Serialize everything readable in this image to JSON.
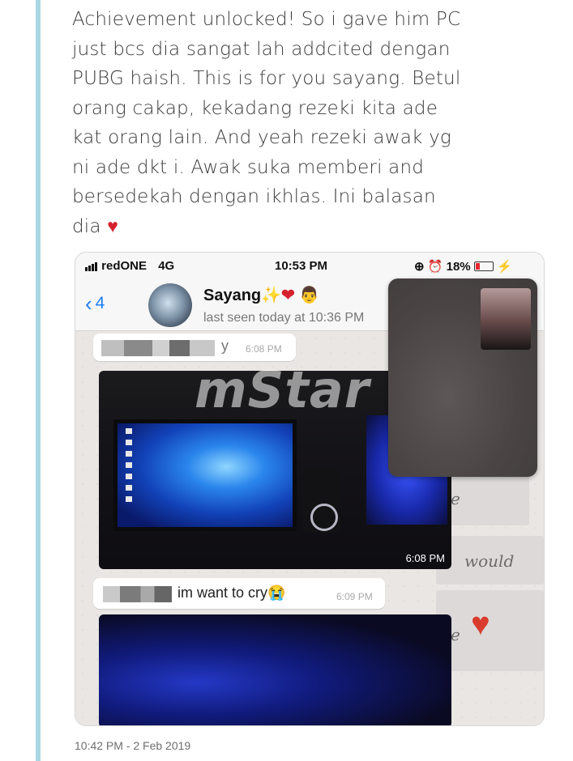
{
  "tweet": {
    "lines": [
      "Achievement unlocked! So i gave him PC",
      "just bcs dia sangat lah addcited dengan",
      "PUBG haish. This is for you sayang. Betul",
      "orang cakap, kekadang rezeki kita ade",
      "kat orang lain. And yeah rezeki awak yg",
      "ni ade dkt i. Awak suka memberi and",
      "bersedekah dengan ikhlas. Ini balasan",
      "dia"
    ],
    "heart": "♥",
    "timestamp": "10:42 PM - 2 Feb 2019"
  },
  "phone": {
    "carrier": "redONE",
    "network": "4G",
    "time": "10:53 PM",
    "battery": "18%",
    "back_count": "4",
    "contact": {
      "name": "Sayang",
      "name_emoji": "✨❤",
      "last_seen": "last seen today at 10:36 PM"
    },
    "messages": [
      {
        "text": "y",
        "time": "6:08 PM"
      },
      {
        "photo_time": "6:08 PM"
      },
      {
        "text": "im want to cry😭",
        "time": "6:09 PM"
      }
    ],
    "doodles": [
      "e",
      "would",
      "e"
    ]
  },
  "watermark": "mStar",
  "colors": {
    "accent_blue": "#1e7cf5",
    "heart_red": "#d6202e",
    "quote_rule": "#a9d7e3"
  }
}
